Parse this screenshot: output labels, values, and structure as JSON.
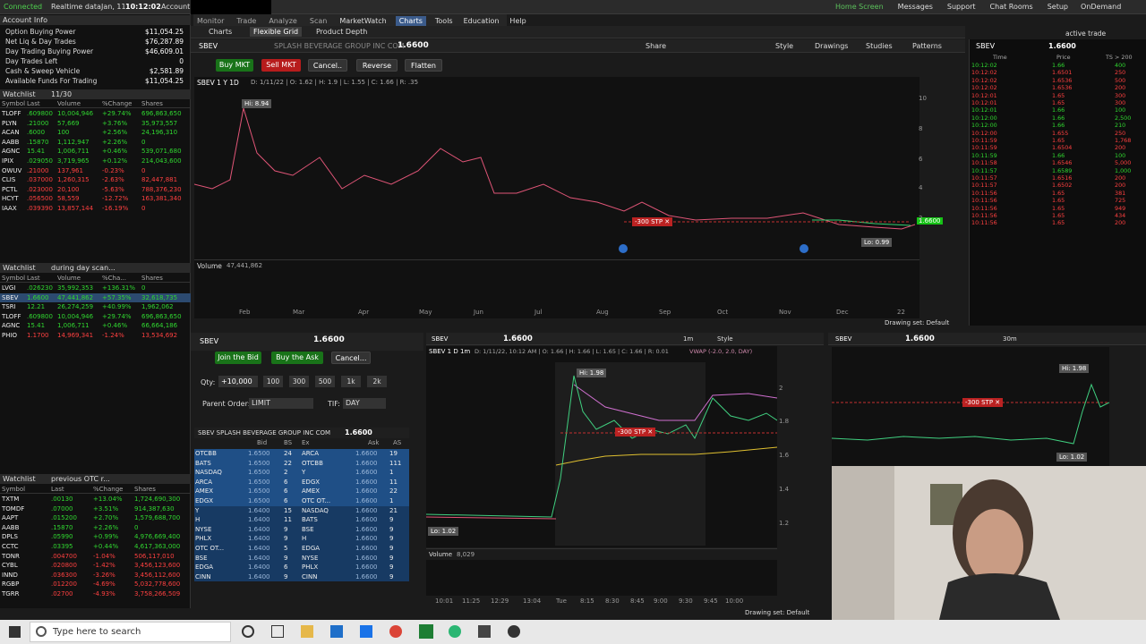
{
  "topbar": {
    "connected": "Connected",
    "realtime": "Realtime data",
    "date": "Jan, 11",
    "time": "10:12:02",
    "account": "Account"
  },
  "menu": [
    "Monitor",
    "Trade",
    "Analyze",
    "Scan",
    "MarketWatch",
    "Charts",
    "Tools",
    "Education",
    "Help"
  ],
  "topright": [
    "Home Screen",
    "Messages",
    "Support",
    "Chat Rooms",
    "Setup",
    "OnDemand"
  ],
  "activeTrade": "active trade",
  "accountInfo": {
    "title": "Account Info",
    "rows": [
      {
        "k": "Option Buying Power",
        "v": "$11,054.25"
      },
      {
        "k": "Net Liq & Day Trades",
        "v": "$76,287.89"
      },
      {
        "k": "Day Trading Buying Power",
        "v": "$46,609.01"
      },
      {
        "k": "Day Trades Left",
        "v": "0"
      },
      {
        "k": "Cash & Sweep Vehicle",
        "v": "$2,581.89"
      },
      {
        "k": "Available Funds For Trading",
        "v": "$11,054.25"
      }
    ]
  },
  "watchlist1": {
    "title": "Watchlist",
    "name": "11/30",
    "cols": [
      "Symbol",
      "Last",
      "Volume",
      "%Change",
      "Shares"
    ],
    "rows": [
      [
        "TLOFF",
        ".609800",
        "10,004,946",
        "+29.74%",
        "696,863,650",
        "green"
      ],
      [
        "PLYN",
        ".21000",
        "57,669",
        "+3.76%",
        "35,973,557",
        "green"
      ],
      [
        "ACAN",
        ".6000",
        "100",
        "+2.56%",
        "24,196,310",
        "green"
      ],
      [
        "AABB",
        ".15870",
        "1,112,947",
        "+2.26%",
        "0",
        "green"
      ],
      [
        "AGNC",
        "15.41",
        "1,006,711",
        "+0.46%",
        "539,071,680",
        "green"
      ],
      [
        "IPIX",
        ".029050",
        "3,719,965",
        "+0.12%",
        "214,043,600",
        "green"
      ],
      [
        "OWUV",
        ".21000",
        "137,961",
        "-0.23%",
        "0",
        "red"
      ],
      [
        "CLIS",
        ".037000",
        "1,260,315",
        "-2.63%",
        "82,447,881",
        "red"
      ],
      [
        "PCTL",
        ".023000",
        "20,100",
        "-5.63%",
        "788,376,230",
        "red"
      ],
      [
        "HCYT",
        ".056500",
        "58,559",
        "-12.72%",
        "163,381,340",
        "red"
      ],
      [
        "IAAX",
        ".039390",
        "13,857,144",
        "-16.19%",
        "0",
        "red"
      ]
    ]
  },
  "watchlist2": {
    "title": "Watchlist",
    "name": "during day scan...",
    "cols": [
      "Symbol",
      "Last",
      "Volume",
      "%Cha...",
      "Shares"
    ],
    "rows": [
      [
        "LVGI",
        ".026230",
        "35,992,353",
        "+136.31%",
        "0",
        "green"
      ],
      [
        "SBEV",
        "1.6600",
        "47,441,862",
        "+57.35%",
        "32,618,735",
        "green"
      ],
      [
        "TSRI",
        "12.21",
        "26,274,259",
        "+40.99%",
        "1,962,062",
        "green"
      ],
      [
        "TLOFF",
        ".609800",
        "10,004,946",
        "+29.74%",
        "696,863,650",
        "green"
      ],
      [
        "AGNC",
        "15.41",
        "1,006,711",
        "+0.46%",
        "66,664,186",
        "green"
      ],
      [
        "PHIO",
        "1.1700",
        "14,969,341",
        "-1.24%",
        "13,534,692",
        "red"
      ]
    ]
  },
  "watchlist3": {
    "title": "Watchlist",
    "name": "previous OTC r...",
    "cols": [
      "Symbol",
      "Last",
      "%Change",
      "Shares"
    ],
    "rows": [
      [
        "TXTM",
        ".00130",
        "+13.04%",
        "1,724,690,300",
        "green"
      ],
      [
        "TOMDF",
        ".07000",
        "+3.51%",
        "914,387,630",
        "green"
      ],
      [
        "AAPT",
        ".015200",
        "+2.70%",
        "1,579,688,700",
        "green"
      ],
      [
        "AABB",
        ".15870",
        "+2.26%",
        "0",
        "green"
      ],
      [
        "DPLS",
        ".05990",
        "+0.99%",
        "4,976,669,400",
        "green"
      ],
      [
        "CCTC",
        ".03395",
        "+0.44%",
        "4,617,363,000",
        "green"
      ],
      [
        "TONR",
        ".004700",
        "-1.04%",
        "506,117,010",
        "red"
      ],
      [
        "CYBL",
        ".020800",
        "-1.42%",
        "3,456,123,600",
        "red"
      ],
      [
        "INND",
        ".036300",
        "-3.26%",
        "3,456,112,600",
        "red"
      ],
      [
        "RGBP",
        ".012200",
        "-4.69%",
        "5,032,778,600",
        "red"
      ],
      [
        "TGRR",
        ".02700",
        "-4.93%",
        "3,758,266,509",
        "red"
      ]
    ]
  },
  "charts": {
    "tabs": [
      "Charts",
      "Flexible Grid",
      "Product Depth"
    ],
    "symbol": "SBEV",
    "company": "SPLASH BEVERAGE GROUP INC COM",
    "price": "1.6600",
    "share": "Share",
    "style": "Style",
    "drawings": "Drawings",
    "studies": "Studies",
    "patterns": "Patterns",
    "buyMkt": "Buy MKT",
    "sellMkt": "Sell MKT",
    "cancel": "Cancel..",
    "reverse": "Reverse",
    "flatten": "Flatten",
    "mainLabel": "SBEV 1 Y 1D",
    "mainOHLC": "D: 1/11/22 | O: 1.62 | H: 1.9 | L: 1.55 | C: 1.66 | R: .35",
    "hi": "Hi: 8.94",
    "lo": "Lo: 0.99",
    "stp": "-300 STP",
    "vol": "Volume",
    "volVal": "47,441,862",
    "months": [
      "Feb",
      "Mar",
      "Apr",
      "May",
      "Jun",
      "Jul",
      "Aug",
      "Sep",
      "Oct",
      "Nov",
      "Dec",
      "22"
    ],
    "yTicks": [
      "10",
      "8",
      "6",
      "4",
      "2"
    ],
    "drawingSet": "Drawing set: Default"
  },
  "activeTrader": {
    "joinBid": "Join the Bid",
    "buyAsk": "Buy the Ask",
    "cancel": "Cancel...",
    "qty": "Qty:",
    "qtyVal": "+10,000",
    "quickQty": [
      "100",
      "300",
      "500",
      "1k",
      "2k"
    ],
    "parent": "Parent Order:",
    "parentVal": "LIMIT",
    "tif": "TIF:",
    "tifVal": "DAY",
    "bookHeader": "SBEV   SPLASH BEVERAGE GROUP INC COM",
    "bookPrice": "1.6600",
    "bidCols": [
      "Ex",
      "Bid",
      "BS"
    ],
    "askCols": [
      "Ex",
      "Ask",
      "AS"
    ],
    "book": [
      [
        "OTCBB",
        "1.6500",
        "24",
        "ARCA",
        "1.6600",
        "19"
      ],
      [
        "BATS",
        "1.6500",
        "22",
        "OTCBB",
        "1.6600",
        "111"
      ],
      [
        "NASDAQ",
        "1.6500",
        "2",
        "Y",
        "1.6600",
        "1"
      ],
      [
        "ARCA",
        "1.6500",
        "6",
        "EDGX",
        "1.6600",
        "11"
      ],
      [
        "AMEX",
        "1.6500",
        "6",
        "AMEX",
        "1.6600",
        "22"
      ],
      [
        "EDGX",
        "1.6500",
        "6",
        "OTC OT...",
        "1.6600",
        "1"
      ],
      [
        "Y",
        "1.6400",
        "15",
        "NASDAQ",
        "1.6600",
        "21"
      ],
      [
        "H",
        "1.6400",
        "11",
        "BATS",
        "1.6600",
        "9"
      ],
      [
        "NYSE",
        "1.6400",
        "9",
        "BSE",
        "1.6600",
        "9"
      ],
      [
        "PHLX",
        "1.6400",
        "9",
        "H",
        "1.6600",
        "9"
      ],
      [
        "OTC OT...",
        "1.6400",
        "5",
        "EDGA",
        "1.6600",
        "9"
      ],
      [
        "BSE",
        "1.6400",
        "9",
        "NYSE",
        "1.6600",
        "9"
      ],
      [
        "EDGA",
        "1.6400",
        "6",
        "PHLX",
        "1.6600",
        "9"
      ],
      [
        "CINN",
        "1.6400",
        "9",
        "CINN",
        "1.6600",
        "9"
      ]
    ]
  },
  "intraday": {
    "label": "SBEV 1 D 1m",
    "ohlc": "D: 1/11/22, 10:12 AM | O: 1.66 | H: 1.66 | L: 1.65 | C: 1.66 | R: 0.01",
    "vwap": "VWAP (-2.0, 2.0, DAY)",
    "hi": "Hi: 1.98",
    "lo": "Lo: 1.02",
    "stp": "-300 STP",
    "vol": "Volume",
    "volVal": "8,029",
    "times": [
      "10:01",
      "11:25",
      "12:29",
      "13:04",
      "Tue",
      "8:15",
      "8:30",
      "8:45",
      "9:00",
      "9:30",
      "9:45",
      "10:00"
    ],
    "yTicks": [
      "2",
      "1.8",
      "1.6",
      "1.4",
      "1.2"
    ],
    "drawingSet": "Drawing set: Default",
    "interval": "1m"
  },
  "third": {
    "interval": "30m",
    "hi": "Hi: 1.98",
    "lo": "Lo: 1.02",
    "stp": "-300 STP"
  },
  "timesales": {
    "symbol": "SBEV",
    "price": "1.6600",
    "cols": [
      "Time",
      "Price",
      "TS > 200"
    ],
    "rows": [
      [
        "10:12:02",
        "1.66",
        "400"
      ],
      [
        "10:12:02",
        "1.6501",
        "250"
      ],
      [
        "10:12:02",
        "1.6536",
        "500"
      ],
      [
        "10:12:02",
        "1.6536",
        "200"
      ],
      [
        "10:12:01",
        "1.65",
        "300"
      ],
      [
        "10:12:01",
        "1.65",
        "300"
      ],
      [
        "10:12:01",
        "1.66",
        "100"
      ],
      [
        "10:12:00",
        "1.66",
        "2,500"
      ],
      [
        "10:12:00",
        "1.66",
        "210"
      ],
      [
        "10:12:00",
        "1.655",
        "250"
      ],
      [
        "10:11:59",
        "1.65",
        "1,768"
      ],
      [
        "10:11:59",
        "1.6504",
        "200"
      ],
      [
        "10:11:59",
        "1.66",
        "100"
      ],
      [
        "10:11:58",
        "1.6546",
        "5,000"
      ],
      [
        "10:11:57",
        "1.6589",
        "1,000"
      ],
      [
        "10:11:57",
        "1.6516",
        "200"
      ],
      [
        "10:11:57",
        "1.6502",
        "200"
      ],
      [
        "10:11:56",
        "1.65",
        "381"
      ],
      [
        "10:11:56",
        "1.65",
        "725"
      ],
      [
        "10:11:56",
        "1.65",
        "949"
      ],
      [
        "10:11:56",
        "1.65",
        "434"
      ],
      [
        "10:11:56",
        "1.65",
        "200"
      ]
    ]
  },
  "taskbar": {
    "search": "Type here to search"
  }
}
